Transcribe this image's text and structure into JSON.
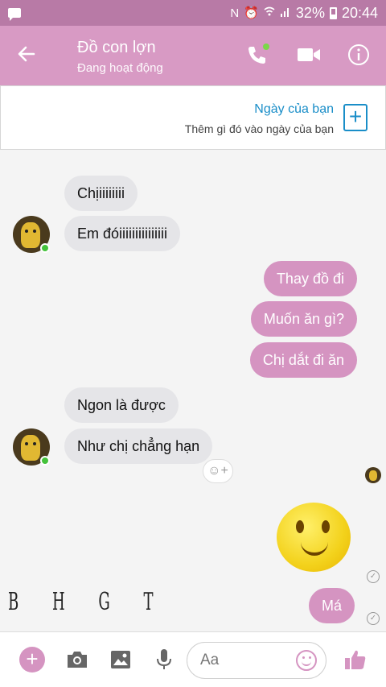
{
  "status_bar": {
    "battery": "32%",
    "time": "20:44"
  },
  "header": {
    "title": "Đồ con lợn",
    "subtitle": "Đang hoạt động"
  },
  "day_banner": {
    "title": "Ngày của bạn",
    "subtitle": "Thêm gì đó vào ngày của bạn"
  },
  "messages": [
    {
      "side": "incoming",
      "text": "Chịiiiiiiii"
    },
    {
      "side": "incoming",
      "text": "Em đóiiiiiiiiiiiiiii"
    },
    {
      "side": "outgoing",
      "text": "Thay đồ đi"
    },
    {
      "side": "outgoing",
      "text": "Muốn ăn gì?"
    },
    {
      "side": "outgoing",
      "text": "Chị dắt đi ăn"
    },
    {
      "side": "incoming",
      "text": "Ngon là được"
    },
    {
      "side": "incoming",
      "text": "Như chị chẳng hạn"
    },
    {
      "side": "outgoing",
      "type": "emoji",
      "emoji": "smiley-face"
    },
    {
      "side": "outgoing",
      "text": "Má"
    }
  ],
  "watermark": "B H G T",
  "composer": {
    "placeholder": "Aa"
  },
  "colors": {
    "header": "#d89ac4",
    "status_bar": "#b87aa6",
    "outgoing_bubble": "#d594c1",
    "incoming_bubble": "#e5e5e8",
    "link": "#1a8ec8",
    "online": "#44c23b"
  },
  "icons": {
    "back": "arrow-left-icon",
    "call": "phone-icon",
    "video": "video-camera-icon",
    "info": "info-icon",
    "add": "plus-icon",
    "camera": "camera-icon",
    "gallery": "image-icon",
    "mic": "microphone-icon",
    "emoji": "smiley-icon",
    "like": "thumbs-up-icon"
  }
}
